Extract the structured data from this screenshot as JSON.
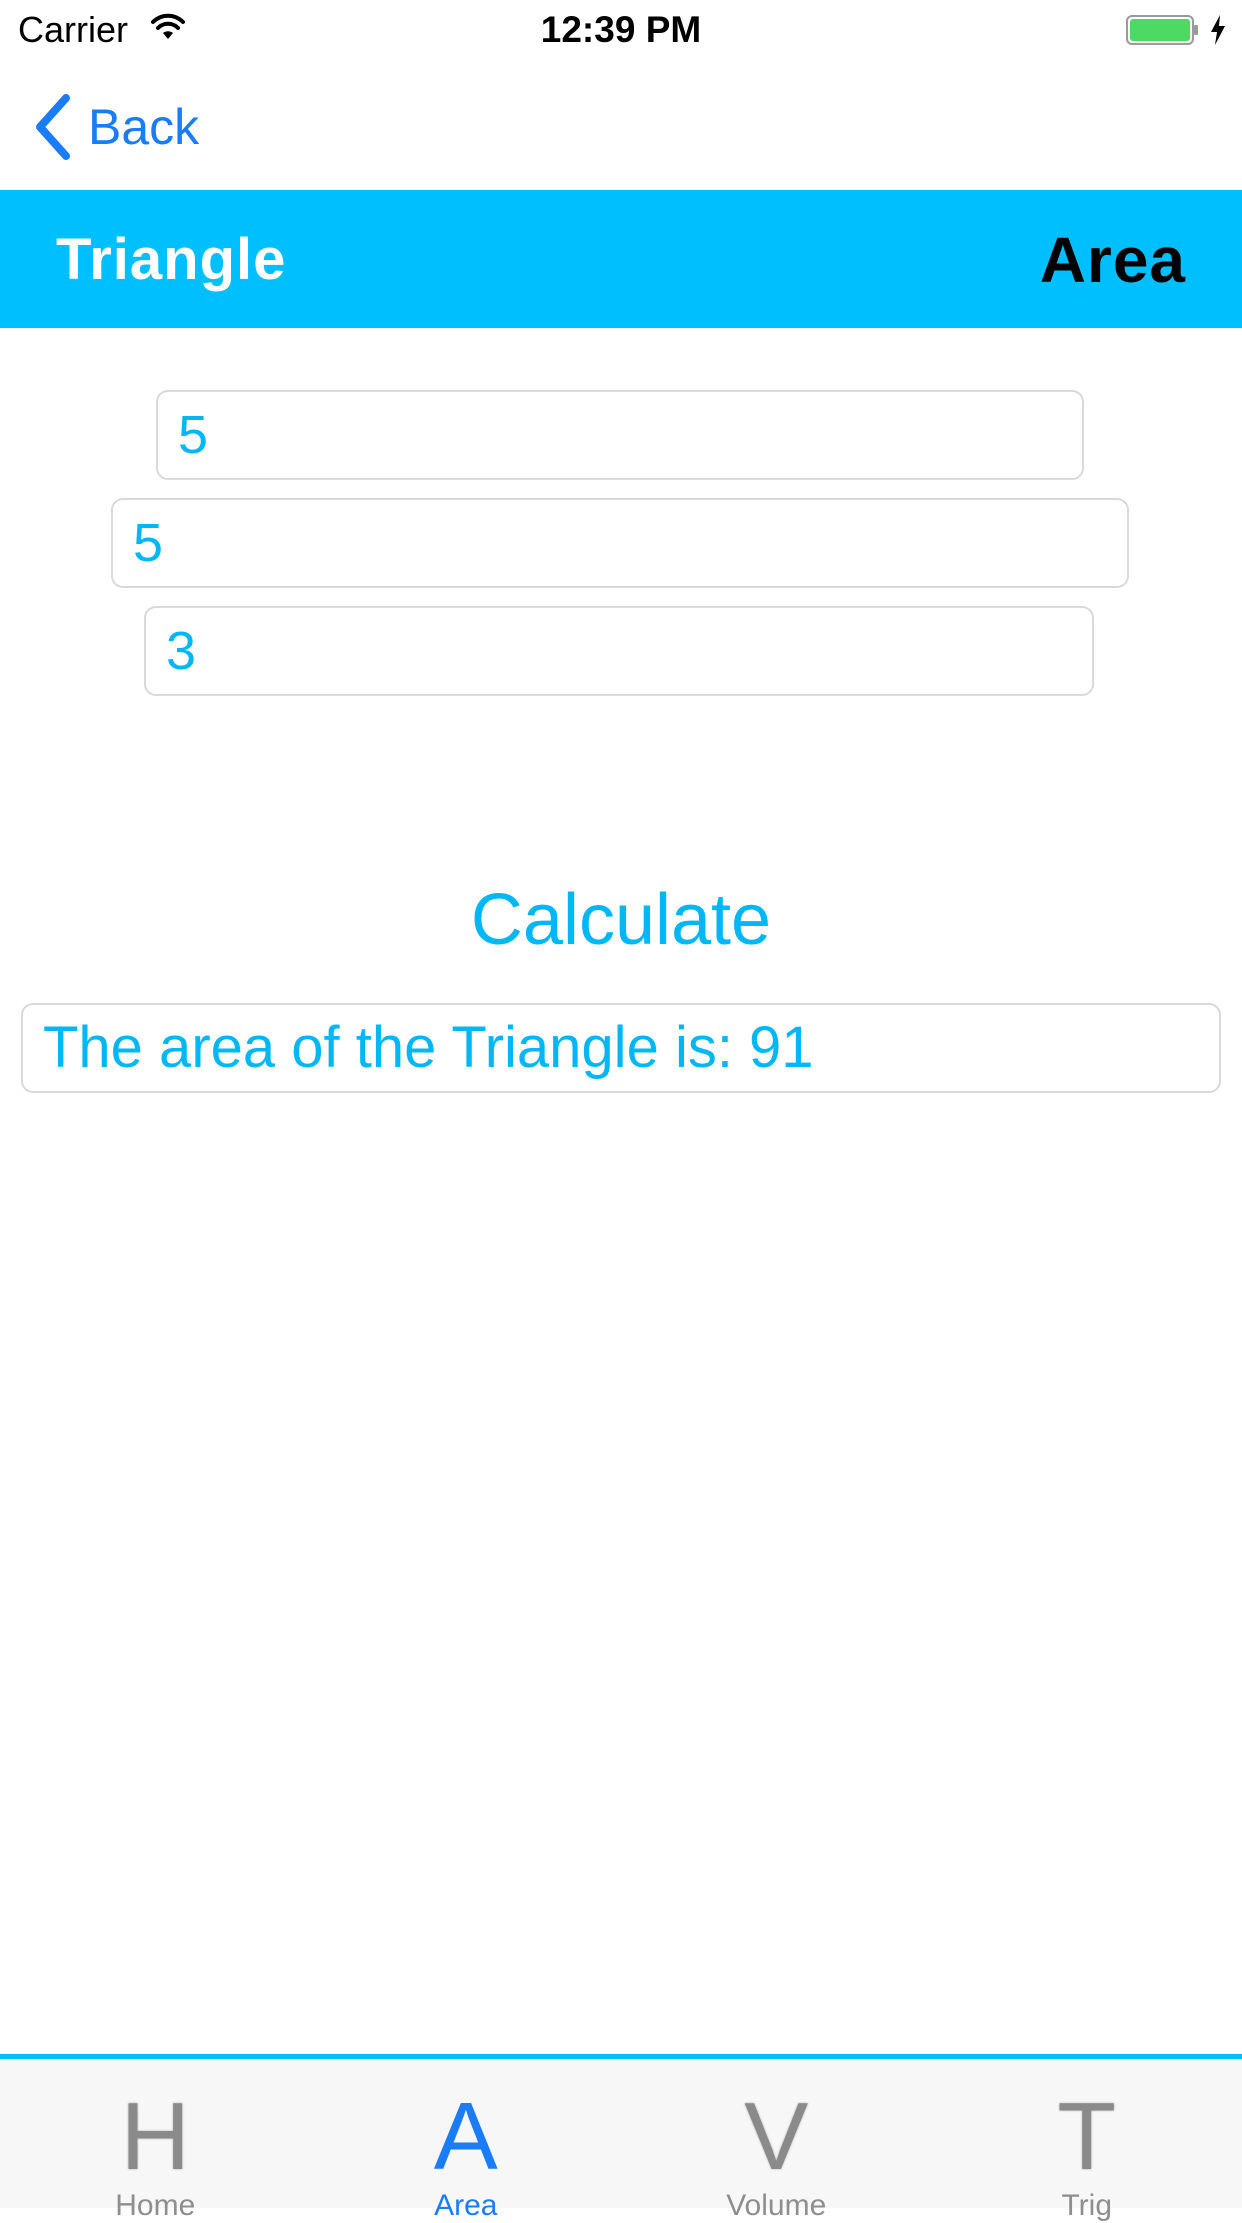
{
  "status_bar": {
    "carrier": "Carrier",
    "time": "12:39 PM",
    "wifi_icon": "wifi-icon",
    "battery_icon": "battery-icon",
    "charging_icon": "charging-bolt-icon",
    "battery_color": "#4cd964"
  },
  "nav": {
    "back_label": "Back",
    "back_icon": "chevron-left-icon",
    "accent_color": "#1a7cf6"
  },
  "header": {
    "title": "Triangle",
    "category": "Area",
    "background_color": "#00bfff"
  },
  "inputs": {
    "side_a": "5",
    "side_b": "5",
    "side_c": "3"
  },
  "calculate": {
    "label": "Calculate"
  },
  "result": {
    "text": "The area of the Triangle is: 91"
  },
  "colors": {
    "text_blue": "#00b7f5"
  },
  "tab_bar": {
    "items": [
      {
        "icon_glyph": "H",
        "label": "Home",
        "active": false
      },
      {
        "icon_glyph": "A",
        "label": "Area",
        "active": true
      },
      {
        "icon_glyph": "V",
        "label": "Volume",
        "active": false
      },
      {
        "icon_glyph": "T",
        "label": "Trig",
        "active": false
      }
    ]
  }
}
